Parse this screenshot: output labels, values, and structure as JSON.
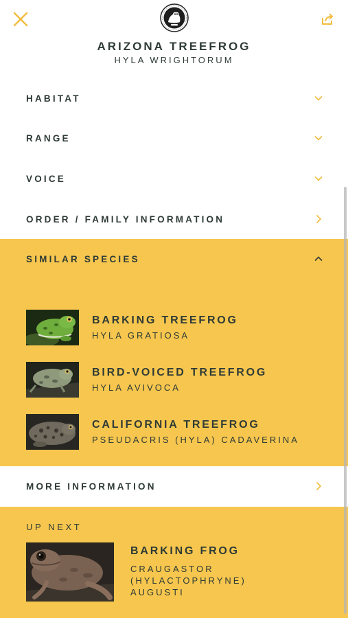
{
  "colors": {
    "accent": "#f6c64e",
    "text": "#2f3b36",
    "icon": "#f2bc3d"
  },
  "header": {
    "title": "ARIZONA TREEFROG",
    "subtitle": "HYLA WRIGHTORUM",
    "close_icon": "close-icon",
    "share_icon": "share-icon",
    "logo_icon": "frog-logo-icon"
  },
  "sections": [
    {
      "label": "HABITAT",
      "icon": "chevron-down-icon"
    },
    {
      "label": "RANGE",
      "icon": "chevron-down-icon"
    },
    {
      "label": "VOICE",
      "icon": "chevron-down-icon"
    },
    {
      "label": "ORDER / FAMILY INFORMATION",
      "icon": "chevron-right-icon"
    }
  ],
  "similar": {
    "label": "SIMILAR SPECIES",
    "icon": "chevron-up-icon",
    "items": [
      {
        "name": "BARKING TREEFROG",
        "scientific": "HYLA GRATIOSA"
      },
      {
        "name": "BIRD-VOICED TREEFROG",
        "scientific": "HYLA AVIVOCA"
      },
      {
        "name": "CALIFORNIA TREEFROG",
        "scientific": "PSEUDACRIS (HYLA) CADAVERINA"
      }
    ]
  },
  "more_info": {
    "label": "MORE INFORMATION",
    "icon": "chevron-right-icon"
  },
  "up_next": {
    "label": "UP NEXT",
    "name": "BARKING FROG",
    "scientific": "CRAUGASTOR (HYLACTOPHRYNE) AUGUSTI"
  }
}
